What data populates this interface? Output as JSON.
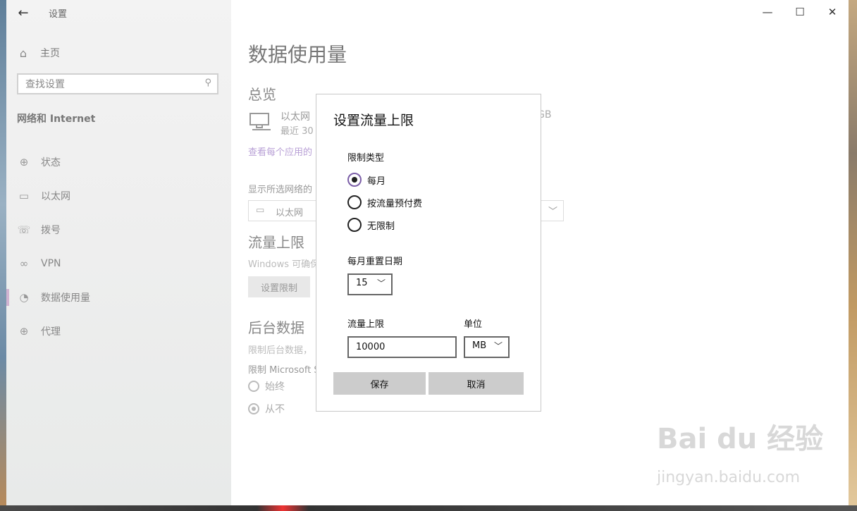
{
  "window": {
    "title": "设置"
  },
  "sidebar": {
    "home_label": "主页",
    "search_placeholder": "查找设置",
    "section_title": "网络和 Internet",
    "items": [
      {
        "label": "状态",
        "icon": "globe-icon"
      },
      {
        "label": "以太网",
        "icon": "ethernet-icon"
      },
      {
        "label": "拨号",
        "icon": "dialup-icon"
      },
      {
        "label": "VPN",
        "icon": "vpn-icon"
      },
      {
        "label": "数据使用量",
        "icon": "pie-icon",
        "selected": true
      },
      {
        "label": "代理",
        "icon": "globe-icon"
      }
    ]
  },
  "main": {
    "page_title": "数据使用量",
    "overview_heading": "总览",
    "ethernet_name": "以太网",
    "ethernet_sub": "最近 30",
    "ethernet_usage_fragment": "GB",
    "apps_link": "查看每个应用的",
    "show_network_label": "显示所选网络的",
    "network_select_value": "以太网",
    "limit_heading": "流量上限",
    "limit_desc": "Windows 可确保",
    "set_limit_button": "设置限制",
    "bg_heading": "后台数据",
    "bg_desc": "限制后台数据，",
    "bg_limit_label": "限制 Microsoft S",
    "bg_options": [
      {
        "label": "始终",
        "selected": false
      },
      {
        "label": "从不",
        "selected": true
      }
    ]
  },
  "dialog": {
    "title": "设置流量上限",
    "limit_type_label": "限制类型",
    "options": [
      {
        "label": "每月",
        "selected": true
      },
      {
        "label": "按流量预付费",
        "selected": false
      },
      {
        "label": "无限制",
        "selected": false
      }
    ],
    "reset_day_label": "每月重置日期",
    "reset_day_value": "15",
    "limit_label": "流量上限",
    "limit_value": "10000",
    "unit_label": "单位",
    "unit_value": "MB",
    "save_label": "保存",
    "cancel_label": "取消"
  },
  "watermark": {
    "brand": "Bai du 经验",
    "url": "jingyan.baidu.com"
  }
}
